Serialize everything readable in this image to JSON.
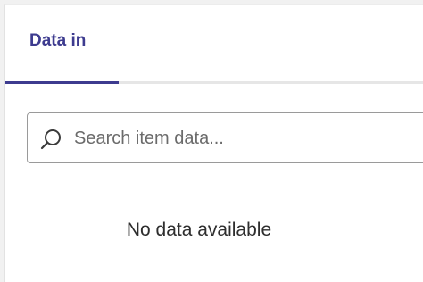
{
  "tabs": [
    {
      "label": "Data in",
      "active": true
    }
  ],
  "search": {
    "placeholder": "Search item data...",
    "value": "",
    "icon": "search-icon"
  },
  "empty_state": {
    "message": "No data available"
  },
  "colors": {
    "accent": "#3d3b8f",
    "border": "#9a9a9a",
    "background": "#ffffff"
  }
}
